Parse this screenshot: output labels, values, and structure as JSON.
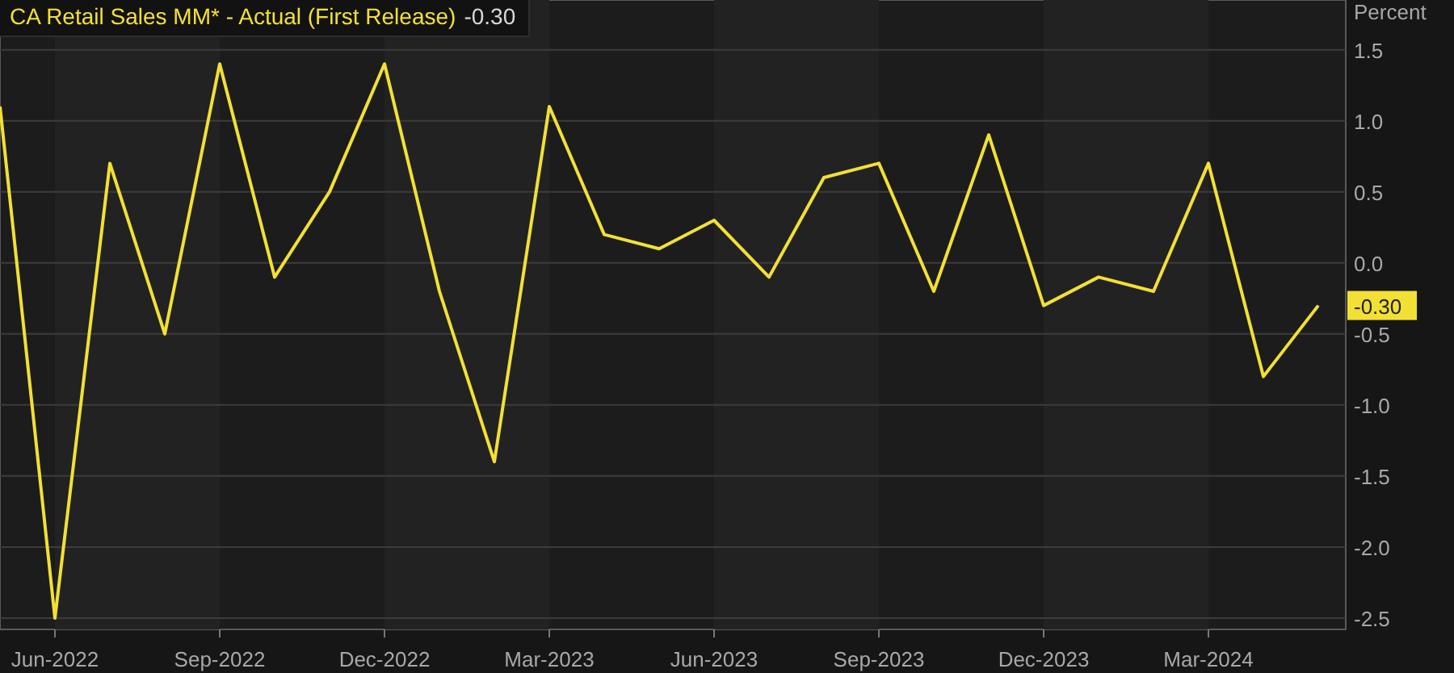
{
  "legend": {
    "value": "-0.30"
  },
  "chart_data": {
    "type": "line",
    "ylabel": "Percent",
    "categories": [
      null,
      "Jun-2022",
      null,
      null,
      "Sep-2022",
      null,
      null,
      "Dec-2022",
      null,
      null,
      "Mar-2023",
      null,
      null,
      "Jun-2023",
      null,
      null,
      "Sep-2023",
      null,
      null,
      "Dec-2023",
      null,
      null,
      "Mar-2024",
      null,
      null
    ],
    "series": [
      {
        "name": "CA Retail Sales MM* - Actual (First Release)",
        "color": "#f2e034",
        "values": [
          1.1,
          -2.5,
          0.7,
          -0.5,
          1.4,
          -0.1,
          0.5,
          1.4,
          -0.2,
          -1.4,
          1.1,
          0.2,
          0.1,
          0.3,
          -0.1,
          0.6,
          0.7,
          -0.2,
          0.9,
          -0.3,
          -0.1,
          -0.2,
          0.7,
          -0.8,
          -0.3
        ]
      }
    ],
    "ylim": [
      -2.58,
      1.85
    ],
    "grid": true,
    "yticks": [
      {
        "value": 1.5,
        "label": "1.5"
      },
      {
        "value": 1,
        "label": "1.0"
      },
      {
        "value": 0.5,
        "label": "0.5"
      },
      {
        "value": 0,
        "label": "0.0"
      },
      {
        "value": -0.5,
        "label": "-0.5"
      },
      {
        "value": -1,
        "label": "-1.0"
      },
      {
        "value": -1.5,
        "label": "-1.5"
      },
      {
        "value": -2,
        "label": "-2.0"
      },
      {
        "value": -2.5,
        "label": "-2.5"
      }
    ],
    "annotations": [
      "-0.30"
    ]
  }
}
